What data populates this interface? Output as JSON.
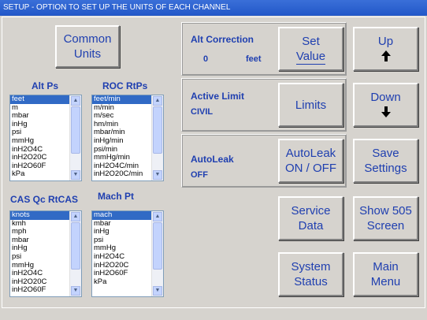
{
  "window": {
    "title": "SETUP - OPTION TO SET UP THE UNITS OF EACH CHANNEL"
  },
  "buttons": {
    "common_units": [
      "Common",
      "Units"
    ],
    "set_value": [
      "Set",
      "Value"
    ],
    "limits": "Limits",
    "autoleak": [
      "AutoLeak",
      "ON / OFF"
    ],
    "service_data": [
      "Service",
      "Data"
    ],
    "system_status": [
      "System",
      "Status"
    ],
    "up": "Up",
    "up_arrow": "🡡",
    "down": "Down",
    "down_arrow": "🡣",
    "save_settings": [
      "Save",
      "Settings"
    ],
    "show_505": [
      "Show 505",
      "Screen"
    ],
    "main_menu": [
      "Main",
      "Menu"
    ]
  },
  "alt_correction": {
    "label": "Alt Correction",
    "value": "0",
    "unit": "feet"
  },
  "active_limit": {
    "label": "Active Limit",
    "value": "CIVIL"
  },
  "autoleak": {
    "label": "AutoLeak",
    "value": "OFF"
  },
  "lists": {
    "alt_ps": {
      "label": "Alt Ps",
      "items": [
        "feet",
        "m",
        "mbar",
        "inHg",
        "psi",
        "mmHg",
        "inH2O4C",
        "inH2O20C",
        "inH2O60F",
        "kPa"
      ],
      "selected": 0
    },
    "roc_rtps": {
      "label": "ROC RtPs",
      "items": [
        "feet/min",
        "m/min",
        "m/sec",
        "hm/min",
        "mbar/min",
        "inHg/min",
        "psi/min",
        "mmHg/min",
        "inH2O4C/min",
        "inH2O20C/min"
      ],
      "selected": 0
    },
    "cas_qc_rtcas": {
      "label": "CAS Qc RtCAS",
      "items": [
        "knots",
        "kmh",
        "mph",
        "mbar",
        "inHg",
        "psi",
        "mmHg",
        "inH2O4C",
        "inH2O20C",
        "inH2O60F"
      ],
      "selected": 0
    },
    "mach_pt": {
      "label": "Mach Pt",
      "items": [
        "mach",
        "mbar",
        "inHg",
        "psi",
        "mmHg",
        "inH2O4C",
        "inH2O20C",
        "inH2O60F",
        "kPa"
      ],
      "selected": 0
    }
  },
  "icons": {
    "up": "arrow-up-icon",
    "down": "arrow-down-icon",
    "scroll_up": "scroll-up-icon",
    "scroll_down": "scroll-down-icon"
  },
  "colors": {
    "titlebar": "#2257c8",
    "text": "#1f3fb0",
    "background": "#d6d3ce",
    "selection": "#316ac5"
  }
}
